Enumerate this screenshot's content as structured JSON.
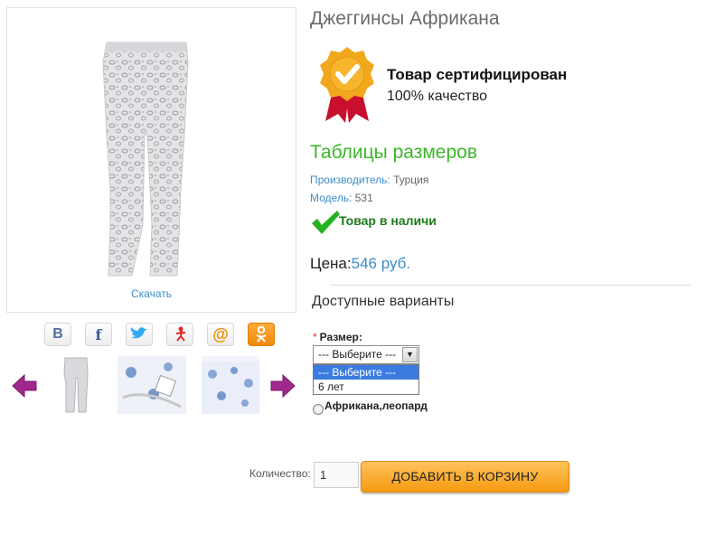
{
  "product": {
    "title": "Джеггинсы Африкана",
    "download_label": "Скачать"
  },
  "certificate": {
    "title": "Товар сертифицирован",
    "subtitle": "100% качество"
  },
  "sizes_link": "Таблицы размеров",
  "info": {
    "manufacturer_label": "Производитель:",
    "manufacturer_value": "Турция",
    "model_label": "Модель:",
    "model_value": "531"
  },
  "stock_text": "Товар в наличи",
  "price": {
    "label": "Цена:",
    "value": "546 руб."
  },
  "variants": {
    "title": "Доступные варианты",
    "size_label": "Размер:",
    "size_required_mark": "*",
    "selected": "--- Выберите ---",
    "options": [
      "--- Выберите ---",
      "6 лет"
    ],
    "radio_label": "Африкана,леопард"
  },
  "social": {
    "icons": [
      "vk-icon",
      "facebook-icon",
      "twitter-icon",
      "odnoklassniki-icon",
      "mailru-icon",
      "ok-icon"
    ],
    "vk_text": "B",
    "fb_text": "f",
    "mail_text": "@"
  },
  "cart": {
    "quantity_label": "Количество:",
    "quantity_value": "1",
    "add_button": "ДОБАВИТЬ В КОРЗИНУ"
  },
  "colors": {
    "accent_blue": "#3a8ec9",
    "green": "#3bb829",
    "button_orange": "#f69a10"
  }
}
